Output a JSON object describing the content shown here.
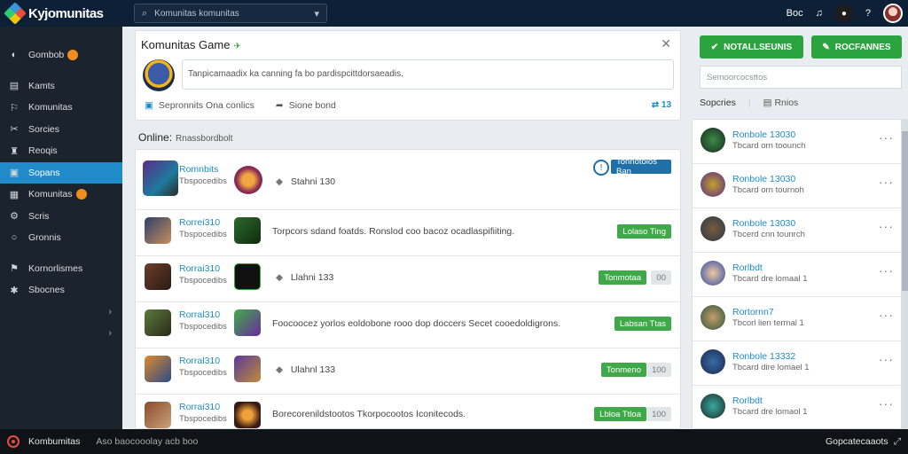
{
  "app": {
    "name": "Kyjomunitas"
  },
  "search": {
    "value": "Komunitas komunitas"
  },
  "header": {
    "user_label": "Boc"
  },
  "colors": {
    "topbar": "#0d2035",
    "sidebar": "#1b232c",
    "accent": "#1f8cc9",
    "green": "#2ba33f",
    "active_nav": "#1f8cc9"
  },
  "sidebar": {
    "items": [
      {
        "label": "Gombob",
        "icon": "game-icon"
      },
      {
        "label": "Kamts",
        "icon": "list-icon"
      },
      {
        "label": "Komunitas",
        "icon": "flag-icon"
      },
      {
        "label": "Sorcies",
        "icon": "tools-icon"
      },
      {
        "label": "Reoqis",
        "icon": "trophy-icon"
      },
      {
        "label": "Sopans",
        "icon": "chat-icon"
      },
      {
        "label": "Komunitas",
        "icon": "group-icon"
      },
      {
        "label": "Scris",
        "icon": "settings-icon"
      },
      {
        "label": "Gronnis",
        "icon": "circle-icon"
      },
      {
        "label": "Kornorlismes",
        "icon": "pin-icon"
      },
      {
        "label": "Sbocnes",
        "icon": "gear-icon"
      }
    ]
  },
  "composer": {
    "title": "Komunitas Game",
    "title_tag": "✈",
    "placeholder": "Tanpicamaadix ka canning fa bo pardispcittdorsaeadis.",
    "action_1": "Sepronnits Ona conlics",
    "action_2": "Sione bond",
    "count": "⇄ 13"
  },
  "online": {
    "label": "Online:",
    "sub": "Rnassbordbolt"
  },
  "feed": [
    {
      "name": "Romnbits",
      "meta": "Tbspocedibs",
      "text": "Stahni 130",
      "button": "Tonnotolos Ban",
      "extra": ""
    },
    {
      "name": "Rorrei310",
      "meta": "Tbspocedibs",
      "text": "Torpcors sdand foatds. Ronslod coo bacoz ocadlaspifiiting.",
      "button": "Lolaso Ting",
      "extra": ""
    },
    {
      "name": "Rorrai310",
      "meta": "Tbspocedibs",
      "text": "Llahni 133",
      "button": "Tonmotaa",
      "extra": "00"
    },
    {
      "name": "Rorral310",
      "meta": "Tbspocedibs",
      "text": "Foocoocez yorlos eoldobone rooo dop doccers Secet cooedoldigrons.",
      "button": "Labsan Ttas",
      "extra": ""
    },
    {
      "name": "Rorral310",
      "meta": "Tbspocedibs",
      "text": "Ulahnl 133",
      "button": "Tonmeno",
      "extra": "100"
    },
    {
      "name": "Rorrai310",
      "meta": "Tbspocedibs",
      "text": "Borecorenildstootos Tkorpocootos Iconitecods.",
      "button": "Lbloa Ttloa",
      "extra": "100"
    }
  ],
  "right_panel": {
    "btn_notifications": "NOTALLSEUNIS",
    "btn_post": "ROCFANNES",
    "search_placeholder": "Semoorcocsttos",
    "tab_1": "Sopcries",
    "tab_2": "Rnios",
    "items": [
      {
        "name": "Ronbole 13030",
        "sub": "Tbcard orn toounch"
      },
      {
        "name": "Ronbole 13030",
        "sub": "Tbcard orn tournoh"
      },
      {
        "name": "Ronbole 13030",
        "sub": "Tbcerd cnn tounrch"
      },
      {
        "name": "Rorlbdt",
        "sub": "Tbcard dre lomaal 1"
      },
      {
        "name": "Rortornn7",
        "sub": "Tbcorl lien termal 1"
      },
      {
        "name": "Ronbole 13332",
        "sub": "Tbcard dire lomael 1"
      },
      {
        "name": "Rorlbdt",
        "sub": "Tbcard dre lomaol 1"
      }
    ]
  },
  "bottom": {
    "title": "Kombumitas",
    "sub": "Aso baocooolay acb boo",
    "right": "Gopcatecaaots"
  }
}
